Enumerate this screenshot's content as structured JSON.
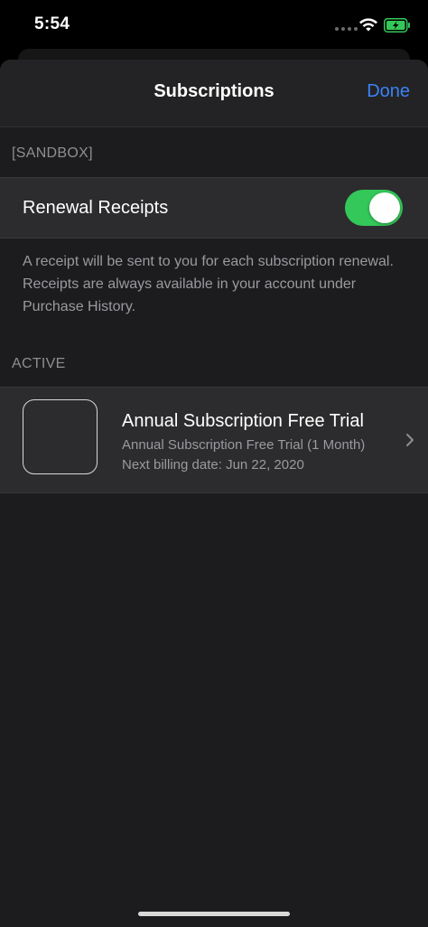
{
  "status_bar": {
    "time": "5:54",
    "wifi_icon": "wifi-icon",
    "battery_icon": "battery-charging-icon",
    "battery_color": "#34c759"
  },
  "nav": {
    "title": "Subscriptions",
    "done_label": "Done",
    "accent_color": "#3b82f6"
  },
  "sandbox_section": {
    "header": "[SANDBOX]",
    "renewal_label": "Renewal Receipts",
    "renewal_toggle_on": true,
    "toggle_color": "#34c759",
    "footer": "A receipt will be sent to you for each subscription renewal. Receipts are always available in your account under Purchase History."
  },
  "active_section": {
    "header": "ACTIVE",
    "subscription": {
      "title": "Annual Subscription Free Trial",
      "plan": "Annual Subscription Free Trial (1 Month)",
      "billing": "Next billing date: Jun 22, 2020",
      "chevron_icon": "chevron-right-icon"
    }
  }
}
